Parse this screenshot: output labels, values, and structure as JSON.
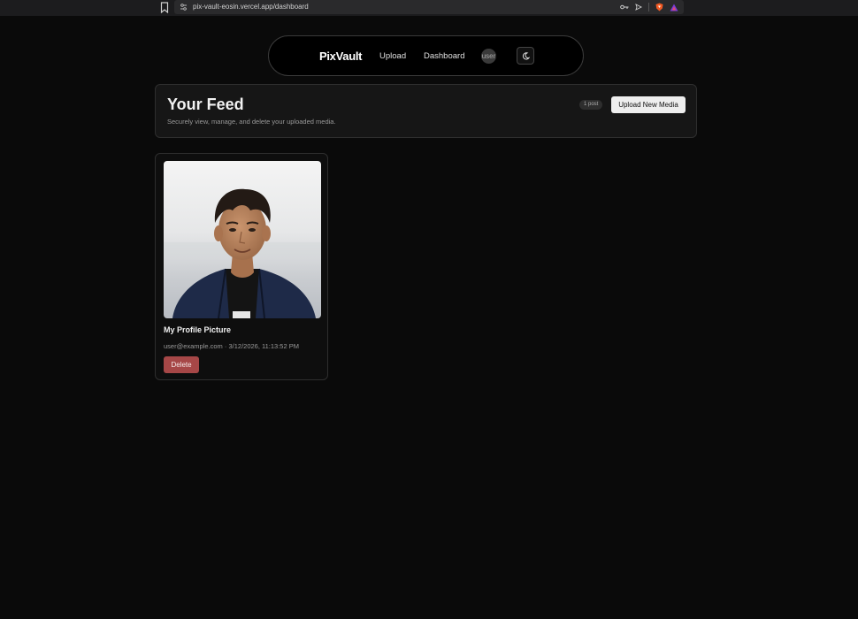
{
  "browser": {
    "url": "pix-vault-eosin.vercel.app/dashboard"
  },
  "nav": {
    "brand": "PixVault",
    "upload_label": "Upload",
    "dashboard_label": "Dashboard",
    "avatar_text": "user"
  },
  "header": {
    "title": "Your Feed",
    "subtitle": "Securely view, manage, and delete your uploaded media.",
    "post_count": "1 post",
    "upload_button": "Upload New Media"
  },
  "posts": [
    {
      "title": "My Profile Picture",
      "meta": "user@example.com · 3/12/2026, 11:13:52 PM",
      "delete_label": "Delete"
    }
  ],
  "colors": {
    "background": "#0a0a0a",
    "delete": "#a64747",
    "primary_button": "#eeeeee"
  }
}
